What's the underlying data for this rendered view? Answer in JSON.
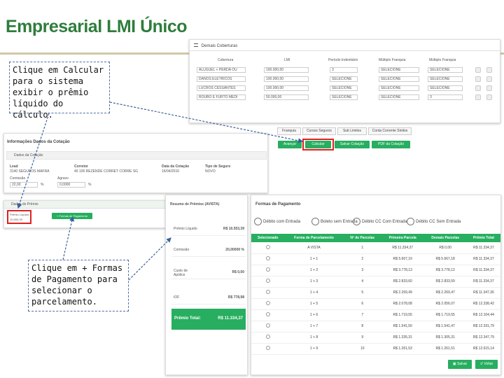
{
  "header": {
    "title": "Empresarial LMI Único"
  },
  "coverages": {
    "title": "Demais Coberturas",
    "columns": [
      "Cobertura",
      "LMI",
      "Período Indenitário",
      "Múltiplo Franquia",
      "Múltiplo Franquia"
    ],
    "rows": [
      {
        "name": "ALUGUEL + PERDA OU",
        "lmi": "100.000,00",
        "period": "3",
        "f1": "SELECIONE",
        "f2": "SELECIONE"
      },
      {
        "name": "DANOS ELETRICOS",
        "lmi": "100.000,00",
        "period": "SELECIONE",
        "f1": "SELECIONE",
        "f2": "SELECIONE"
      },
      {
        "name": "LUCROS CESSANTES",
        "lmi": "100.000,00",
        "period": "SELECIONE",
        "f1": "SELECIONE",
        "f2": "SELECIONE"
      },
      {
        "name": "ROUBO E FURTO MEDI",
        "lmi": "50.000,00",
        "period": "SELECIONE",
        "f1": "SELECIONE",
        "f2": "3"
      }
    ]
  },
  "callout1": {
    "text": "Clique em Calcular para o sistema exibir o prêmio líquido do cálculo."
  },
  "callout2": {
    "text": "Clique em + Formas de Pagamento para selecionar o parcelamento."
  },
  "toolbar": {
    "tabs": [
      "Franquia",
      "Cursos Seguros",
      "Sub Limites",
      "Conta Corrente Sinitos"
    ],
    "buttons": [
      "Avançar",
      "Calcular",
      "Salvar Cotação",
      "PDF da Cotação"
    ]
  },
  "quote_info": {
    "title": "Informações Dados da Cotação",
    "subtitle": "Dados da Cotação",
    "fields": [
      {
        "label": "Lead",
        "value": "3140 SEGUROS MAFRA"
      },
      {
        "label": "Corretor",
        "value": "40 100 REZENDE CORRET CORRE SG"
      },
      {
        "label": "Data da Cotação",
        "value": "16/04/2016"
      },
      {
        "label": "Tipo de Seguro",
        "value": "NOVO"
      }
    ],
    "comissao_label": "Comissão",
    "comissao_value": "22,00",
    "agravo_label": "Agravo",
    "agravo_value": "0,0000",
    "pct": "%"
  },
  "premium_panel": {
    "title": "Dados do Prêmio",
    "liquid_label": "Prêmio Líquido:",
    "liquid_value": "10.653,39",
    "add_payment": "+ Formas de Pagamento"
  },
  "summary": {
    "title": "Resumo de Prêmios (AVISTA)",
    "rows": [
      {
        "label": "Prêmio Líquido",
        "value": "R$ 10.553,39"
      },
      {
        "label": "Comissão",
        "value": "20,00000 %"
      },
      {
        "label": "Custo de Apólice",
        "value": "R$ 0,00"
      },
      {
        "label": "IOF",
        "value": "R$ 778,98"
      }
    ],
    "total_label": "Prêmio Total:",
    "total_value": "R$ 11.334,37"
  },
  "payment": {
    "title": "Formas de Pagamento",
    "methods": [
      "Débito com Entrada",
      "Boleto sem Entrada",
      "Débito CC Com Entrada",
      "Débito CC Sem Entrada"
    ],
    "columns": [
      "Selecionado",
      "Forma de Parcelamento",
      "Nº de Parcelas",
      "Primeira Parcela",
      "Demais Parcelas",
      "Prêmio Total"
    ],
    "rows": [
      [
        "A VISTA",
        "1",
        "R$ 11.334,37",
        "R$ 0,00",
        "R$ 11.334,37"
      ],
      [
        "1 + 1",
        "2",
        "R$ 5.667,19",
        "R$ 5.667,18",
        "R$ 11.334,37"
      ],
      [
        "1 + 2",
        "3",
        "R$ 3.778,13",
        "R$ 3.778,12",
        "R$ 11.334,37"
      ],
      [
        "1 + 3",
        "4",
        "R$ 2.833,60",
        "R$ 2.833,59",
        "R$ 11.334,37"
      ],
      [
        "1 + 4",
        "5",
        "R$ 2.269,49",
        "R$ 2.269,47",
        "R$ 11.347,36"
      ],
      [
        "1 + 5",
        "6",
        "R$ 2.078,08",
        "R$ 2.056,07",
        "R$ 12.338,42"
      ],
      [
        "1 + 6",
        "7",
        "R$ 1.719,55",
        "R$ 1.719,55",
        "R$ 12.104,44"
      ],
      [
        "1 + 7",
        "8",
        "R$ 1.541,50",
        "R$ 1.541,47",
        "R$ 12.331,79"
      ],
      [
        "1 + 8",
        "9",
        "R$ 1.335,31",
        "R$ 1.305,31",
        "R$ 12.347,79"
      ],
      [
        "1 + 9",
        "10",
        "R$ 1.261,53",
        "R$ 1.261,51",
        "R$ 12.615,14"
      ]
    ],
    "save_label": "Salvar",
    "back_label": "Voltar"
  },
  "colors": {
    "accent": "#27ae60",
    "title": "#2e7d3c",
    "highlight": "#e02020"
  }
}
